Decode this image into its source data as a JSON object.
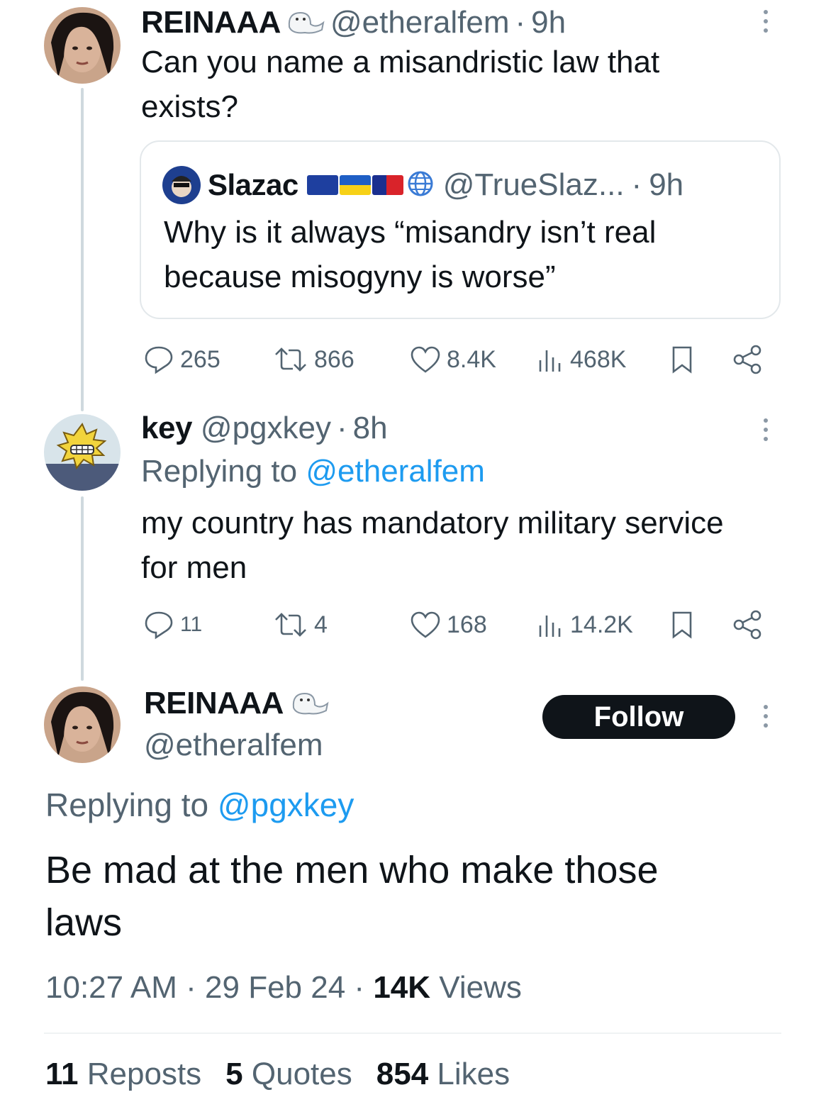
{
  "tweet1": {
    "display_name": "REINAAA",
    "handle": "@etheralfem",
    "time": "9h",
    "text": "Can you name a misandristic law that exists?",
    "quote": {
      "display_name": "Slazac",
      "handle": "@TrueSlaz...",
      "time": "9h",
      "text": "Why is it always “misandry isn’t real because misogyny is worse”"
    },
    "stats": {
      "replies": "265",
      "reposts": "866",
      "likes": "8.4K",
      "views": "468K"
    }
  },
  "tweet2": {
    "display_name": "key",
    "handle": "@pgxkey",
    "time": "8h",
    "replying_prefix": "Replying to",
    "replying_to": "@etheralfem",
    "text": "my country has mandatory military service for men",
    "stats": {
      "replies": "11",
      "reposts": "4",
      "likes": "168",
      "views": "14.2K"
    }
  },
  "main_tweet": {
    "display_name": "REINAAA",
    "handle": "@etheralfem",
    "follow_label": "Follow",
    "replying_prefix": "Replying to",
    "replying_to": "@pgxkey",
    "text": "Be mad at the men who make those laws",
    "time": "10:27 AM",
    "date": "29 Feb 24",
    "views_count": "14K",
    "views_label": "Views",
    "reposts_count": "11",
    "reposts_label": "Reposts",
    "quotes_count": "5",
    "quotes_label": "Quotes",
    "likes_count": "854",
    "likes_label": "Likes"
  },
  "colors": {
    "text": "#0f1419",
    "secondary": "#536471",
    "link": "#1d9bf0",
    "border": "#e3e8eb"
  },
  "icons": [
    "seal-emoji-icon",
    "reply-icon",
    "repost-icon",
    "like-icon",
    "views-icon",
    "bookmark-icon",
    "share-icon",
    "more-icon",
    "globe-icon"
  ]
}
